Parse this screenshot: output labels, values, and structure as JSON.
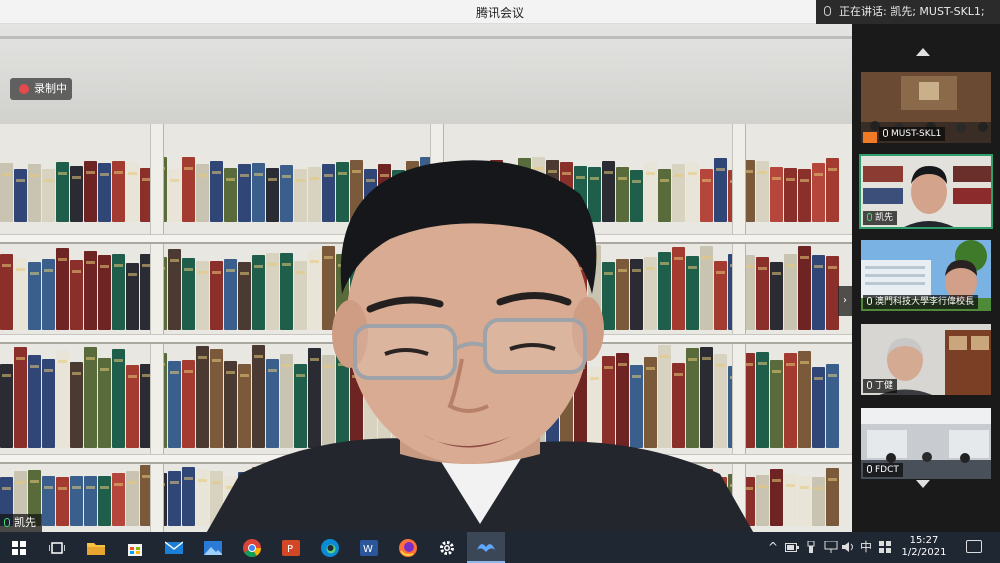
{
  "window": {
    "title": "腾讯会议",
    "speaking_now": "正在讲话: 凯先; MUST-SKL1;"
  },
  "main_video": {
    "recording_label": "录制中",
    "speaker_name": "凯先"
  },
  "participants": [
    {
      "name": "MUST-SKL1",
      "mic_on": false,
      "active": false
    },
    {
      "name": "凯先",
      "mic_on": true,
      "active": true
    },
    {
      "name": "澳門科技大學李行偉校長",
      "mic_on": false,
      "active": false
    },
    {
      "name": "丁健",
      "mic_on": false,
      "active": false
    },
    {
      "name": "FDCT",
      "mic_on": false,
      "active": false
    }
  ],
  "taskbar": {
    "apps": [
      "start-icon",
      "task-view-icon",
      "file-explorer-icon",
      "store-icon",
      "mail-icon",
      "photos-icon",
      "chrome-icon",
      "powerpoint-icon",
      "edge-icon",
      "word-icon",
      "firefox-icon",
      "settings-icon",
      "tencent-meeting-icon"
    ],
    "active_app": "tencent-meeting-icon",
    "ime": "中",
    "time": "15:27",
    "date": "1/2/2021"
  },
  "colors": {
    "accent_green": "#3ddc70",
    "record_red": "#e5484d",
    "taskbar_bg": "#1f2733"
  }
}
